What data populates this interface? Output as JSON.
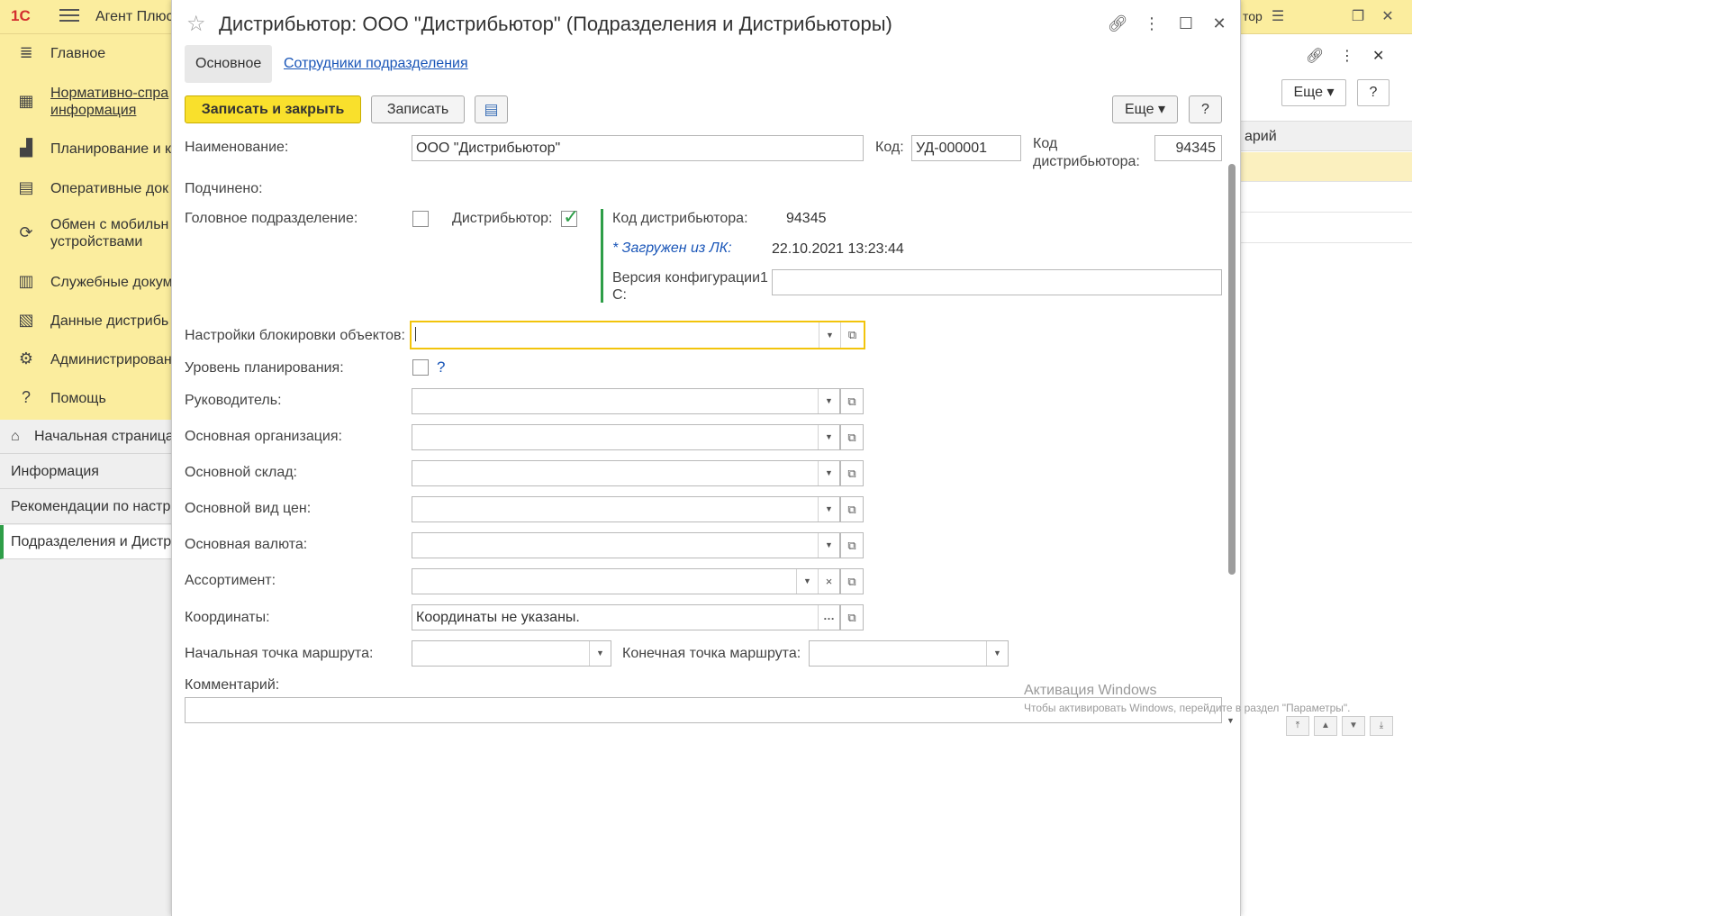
{
  "app": {
    "logo": "1С",
    "title": "Агент Плюс",
    "title_right": "тор"
  },
  "sidebar": {
    "items": [
      {
        "label": "Главное",
        "icon": "list-icon"
      },
      {
        "label": "Нормативно-справочная информация",
        "label_lines": [
          "Нормативно-спра",
          "информация"
        ],
        "icon": "catalog-icon"
      },
      {
        "label": "Планирование и к",
        "icon": "chart-icon"
      },
      {
        "label": "Оперативные док",
        "icon": "documents-icon"
      },
      {
        "label": "Обмен с мобильными устройствами",
        "label_lines": [
          "Обмен с мобильн",
          "устройствами"
        ],
        "icon": "sync-icon"
      },
      {
        "label": "Служебные докум",
        "icon": "service-docs-icon"
      },
      {
        "label": "Данные дистрибь",
        "icon": "distributor-data-icon"
      },
      {
        "label": "Администрирован",
        "icon": "gear-icon"
      },
      {
        "label": "Помощь",
        "icon": "help-icon"
      }
    ]
  },
  "open_windows": [
    {
      "label": "Начальная страница",
      "icon": "home-icon"
    },
    {
      "label": "Информация"
    },
    {
      "label": "Рекомендации по настр"
    },
    {
      "label": "Подразделения и Дистр",
      "active": true
    }
  ],
  "background_panel": {
    "more_label": "Еще",
    "help_label": "?",
    "column_header": "арий"
  },
  "dialog": {
    "title": "Дистрибьютор: ООО \"Дистрибьютор\" (Подразделения и Дистрибьюторы)",
    "tabs": [
      {
        "label": "Основное",
        "active": true
      },
      {
        "label": "Сотрудники подразделения",
        "active": false
      }
    ],
    "toolbar": {
      "save_close_label": "Записать и закрыть",
      "save_label": "Записать",
      "more_label": "Еще",
      "help_label": "?"
    },
    "form": {
      "name_label": "Наименование:",
      "name_value": "ООО \"Дистрибьютор\"",
      "code_label": "Код:",
      "code_value": "УД-000001",
      "dist_code_label_lines": [
        "Код",
        "дистрибьютора:"
      ],
      "dist_code_value": "94345",
      "subordinate_label": "Подчинено:",
      "head_division_label": "Головное подразделение:",
      "head_division_checked": false,
      "distributor_label": "Дистрибьютор:",
      "distributor_checked": true,
      "dist_info": {
        "code_label": "Код дистрибьютора:",
        "code_value": "94345",
        "loaded_label": "* Загружен из ЛК:",
        "loaded_value": "22.10.2021 13:23:44",
        "config_version_label_lines": [
          "Версия конфигурации1",
          "С:"
        ],
        "config_version_value": ""
      },
      "lock_settings_label": "Настройки блокировки объектов:",
      "lock_settings_value": "",
      "planning_level_label": "Уровень планирования:",
      "planning_level_checked": false,
      "planning_help": "?",
      "manager_label": "Руководитель:",
      "manager_value": "",
      "main_org_label": "Основная организация:",
      "main_org_value": "",
      "main_warehouse_label": "Основной склад:",
      "main_warehouse_value": "",
      "main_price_type_label": "Основной вид цен:",
      "main_price_type_value": "",
      "main_currency_label": "Основная валюта:",
      "main_currency_value": "",
      "assortment_label": "Ассортимент:",
      "assortment_value": "",
      "coords_label": "Координаты:",
      "coords_value": "Координаты не указаны.",
      "route_start_label": "Начальная точка маршрута:",
      "route_start_value": "",
      "route_end_label": "Конечная точка маршрута:",
      "route_end_value": "",
      "comment_label": "Комментарий:",
      "comment_value": ""
    }
  },
  "watermark": {
    "line1": "Активация Windows",
    "line2": "Чтобы активировать Windows, перейдите в раздел \"Параметры\"."
  },
  "colors": {
    "accent_yellow": "#f9e02c",
    "panel_yellow": "#fbed9e",
    "link_blue": "#1a56b8",
    "check_green": "#2e9e48",
    "focus_border": "#f2c40c"
  }
}
